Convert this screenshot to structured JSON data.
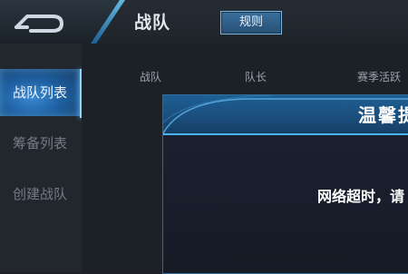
{
  "header": {
    "title": "战队",
    "rules_label": "规则"
  },
  "sidebar": {
    "items": [
      {
        "label": "战队列表",
        "active": true
      },
      {
        "label": "筹备列表",
        "active": false
      },
      {
        "label": "创建战队",
        "active": false
      }
    ]
  },
  "table": {
    "columns": [
      "战队",
      "队长",
      "赛季活跃"
    ]
  },
  "dialog": {
    "title": "温馨提",
    "message": "网络超时，请"
  },
  "colors": {
    "accent": "#4fb2f0",
    "active_tab": "#2a76bd",
    "background": "#1e2228"
  },
  "icons": {
    "back": "back-arrow-icon"
  }
}
